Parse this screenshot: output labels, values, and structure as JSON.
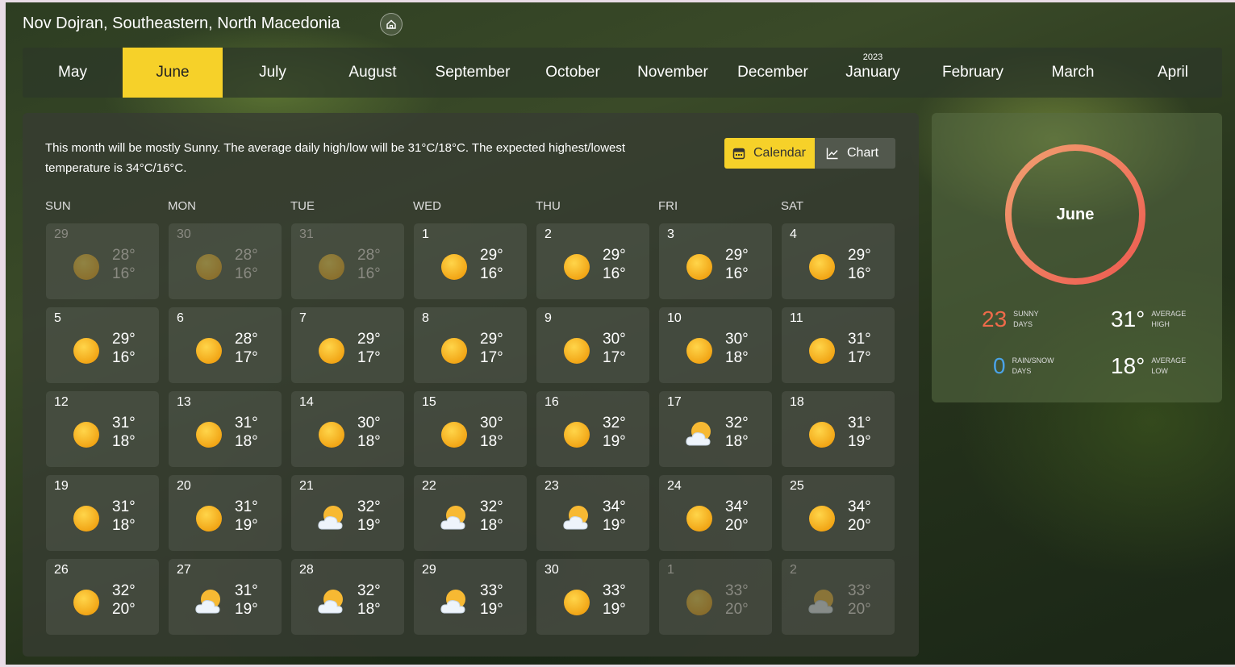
{
  "location": "Nov Dojran, Southeastern, North Macedonia",
  "months": [
    {
      "name": "May",
      "year": ""
    },
    {
      "name": "June",
      "year": "",
      "active": true
    },
    {
      "name": "July",
      "year": ""
    },
    {
      "name": "August",
      "year": ""
    },
    {
      "name": "September",
      "year": ""
    },
    {
      "name": "October",
      "year": ""
    },
    {
      "name": "November",
      "year": ""
    },
    {
      "name": "December",
      "year": ""
    },
    {
      "name": "January",
      "year": "2023"
    },
    {
      "name": "February",
      "year": ""
    },
    {
      "name": "March",
      "year": ""
    },
    {
      "name": "April",
      "year": ""
    }
  ],
  "summary": "This month will be mostly Sunny. The average daily high/low will be 31°C/18°C. The expected highest/lowest temperature is 34°C/16°C.",
  "toggle": {
    "calendar": "Calendar",
    "chart": "Chart"
  },
  "weekdays": [
    "SUN",
    "MON",
    "TUE",
    "WED",
    "THU",
    "FRI",
    "SAT"
  ],
  "days": [
    {
      "d": "29",
      "hi": "28°",
      "lo": "16°",
      "icon": "sun-icon",
      "dim": true
    },
    {
      "d": "30",
      "hi": "28°",
      "lo": "16°",
      "icon": "sun-icon",
      "dim": true
    },
    {
      "d": "31",
      "hi": "28°",
      "lo": "16°",
      "icon": "sun-icon",
      "dim": true
    },
    {
      "d": "1",
      "hi": "29°",
      "lo": "16°",
      "icon": "sun-icon"
    },
    {
      "d": "2",
      "hi": "29°",
      "lo": "16°",
      "icon": "sun-icon"
    },
    {
      "d": "3",
      "hi": "29°",
      "lo": "16°",
      "icon": "sun-icon"
    },
    {
      "d": "4",
      "hi": "29°",
      "lo": "16°",
      "icon": "sun-icon"
    },
    {
      "d": "5",
      "hi": "29°",
      "lo": "16°",
      "icon": "sun-icon"
    },
    {
      "d": "6",
      "hi": "28°",
      "lo": "17°",
      "icon": "sun-icon"
    },
    {
      "d": "7",
      "hi": "29°",
      "lo": "17°",
      "icon": "sun-icon"
    },
    {
      "d": "8",
      "hi": "29°",
      "lo": "17°",
      "icon": "sun-icon"
    },
    {
      "d": "9",
      "hi": "30°",
      "lo": "17°",
      "icon": "sun-icon"
    },
    {
      "d": "10",
      "hi": "30°",
      "lo": "18°",
      "icon": "sun-icon"
    },
    {
      "d": "11",
      "hi": "31°",
      "lo": "17°",
      "icon": "sun-icon"
    },
    {
      "d": "12",
      "hi": "31°",
      "lo": "18°",
      "icon": "sun-icon"
    },
    {
      "d": "13",
      "hi": "31°",
      "lo": "18°",
      "icon": "sun-icon"
    },
    {
      "d": "14",
      "hi": "30°",
      "lo": "18°",
      "icon": "sun-icon"
    },
    {
      "d": "15",
      "hi": "30°",
      "lo": "18°",
      "icon": "sun-icon"
    },
    {
      "d": "16",
      "hi": "32°",
      "lo": "19°",
      "icon": "sun-icon"
    },
    {
      "d": "17",
      "hi": "32°",
      "lo": "18°",
      "icon": "partly-cloudy-icon"
    },
    {
      "d": "18",
      "hi": "31°",
      "lo": "19°",
      "icon": "sun-icon"
    },
    {
      "d": "19",
      "hi": "31°",
      "lo": "18°",
      "icon": "sun-icon"
    },
    {
      "d": "20",
      "hi": "31°",
      "lo": "19°",
      "icon": "sun-icon"
    },
    {
      "d": "21",
      "hi": "32°",
      "lo": "19°",
      "icon": "partly-cloudy-icon"
    },
    {
      "d": "22",
      "hi": "32°",
      "lo": "18°",
      "icon": "partly-cloudy-icon"
    },
    {
      "d": "23",
      "hi": "34°",
      "lo": "19°",
      "icon": "partly-cloudy-icon"
    },
    {
      "d": "24",
      "hi": "34°",
      "lo": "20°",
      "icon": "sun-icon"
    },
    {
      "d": "25",
      "hi": "34°",
      "lo": "20°",
      "icon": "sun-icon"
    },
    {
      "d": "26",
      "hi": "32°",
      "lo": "20°",
      "icon": "sun-icon"
    },
    {
      "d": "27",
      "hi": "31°",
      "lo": "19°",
      "icon": "partly-cloudy-icon"
    },
    {
      "d": "28",
      "hi": "32°",
      "lo": "18°",
      "icon": "partly-cloudy-icon"
    },
    {
      "d": "29",
      "hi": "33°",
      "lo": "19°",
      "icon": "partly-cloudy-icon"
    },
    {
      "d": "30",
      "hi": "33°",
      "lo": "19°",
      "icon": "sun-icon"
    },
    {
      "d": "1",
      "hi": "33°",
      "lo": "20°",
      "icon": "sun-icon",
      "dim": true
    },
    {
      "d": "2",
      "hi": "33°",
      "lo": "20°",
      "icon": "partly-cloudy-icon",
      "dim": true
    }
  ],
  "sidebar": {
    "month": "June",
    "sunny_days": "23",
    "sunny_label_1": "SUNNY",
    "sunny_label_2": "DAYS",
    "rain_days": "0",
    "rain_label_1": "RAIN/SNOW",
    "rain_label_2": "DAYS",
    "avg_high": "31°",
    "high_label_1": "AVERAGE",
    "high_label_2": "HIGH",
    "avg_low": "18°",
    "low_label_1": "AVERAGE",
    "low_label_2": "LOW"
  },
  "colors": {
    "accent": "#f6d129",
    "sunny": "#ee6a4a",
    "rain": "#4aa3e8",
    "ring_start": "#f0a070",
    "ring_end": "#ee5a50"
  }
}
